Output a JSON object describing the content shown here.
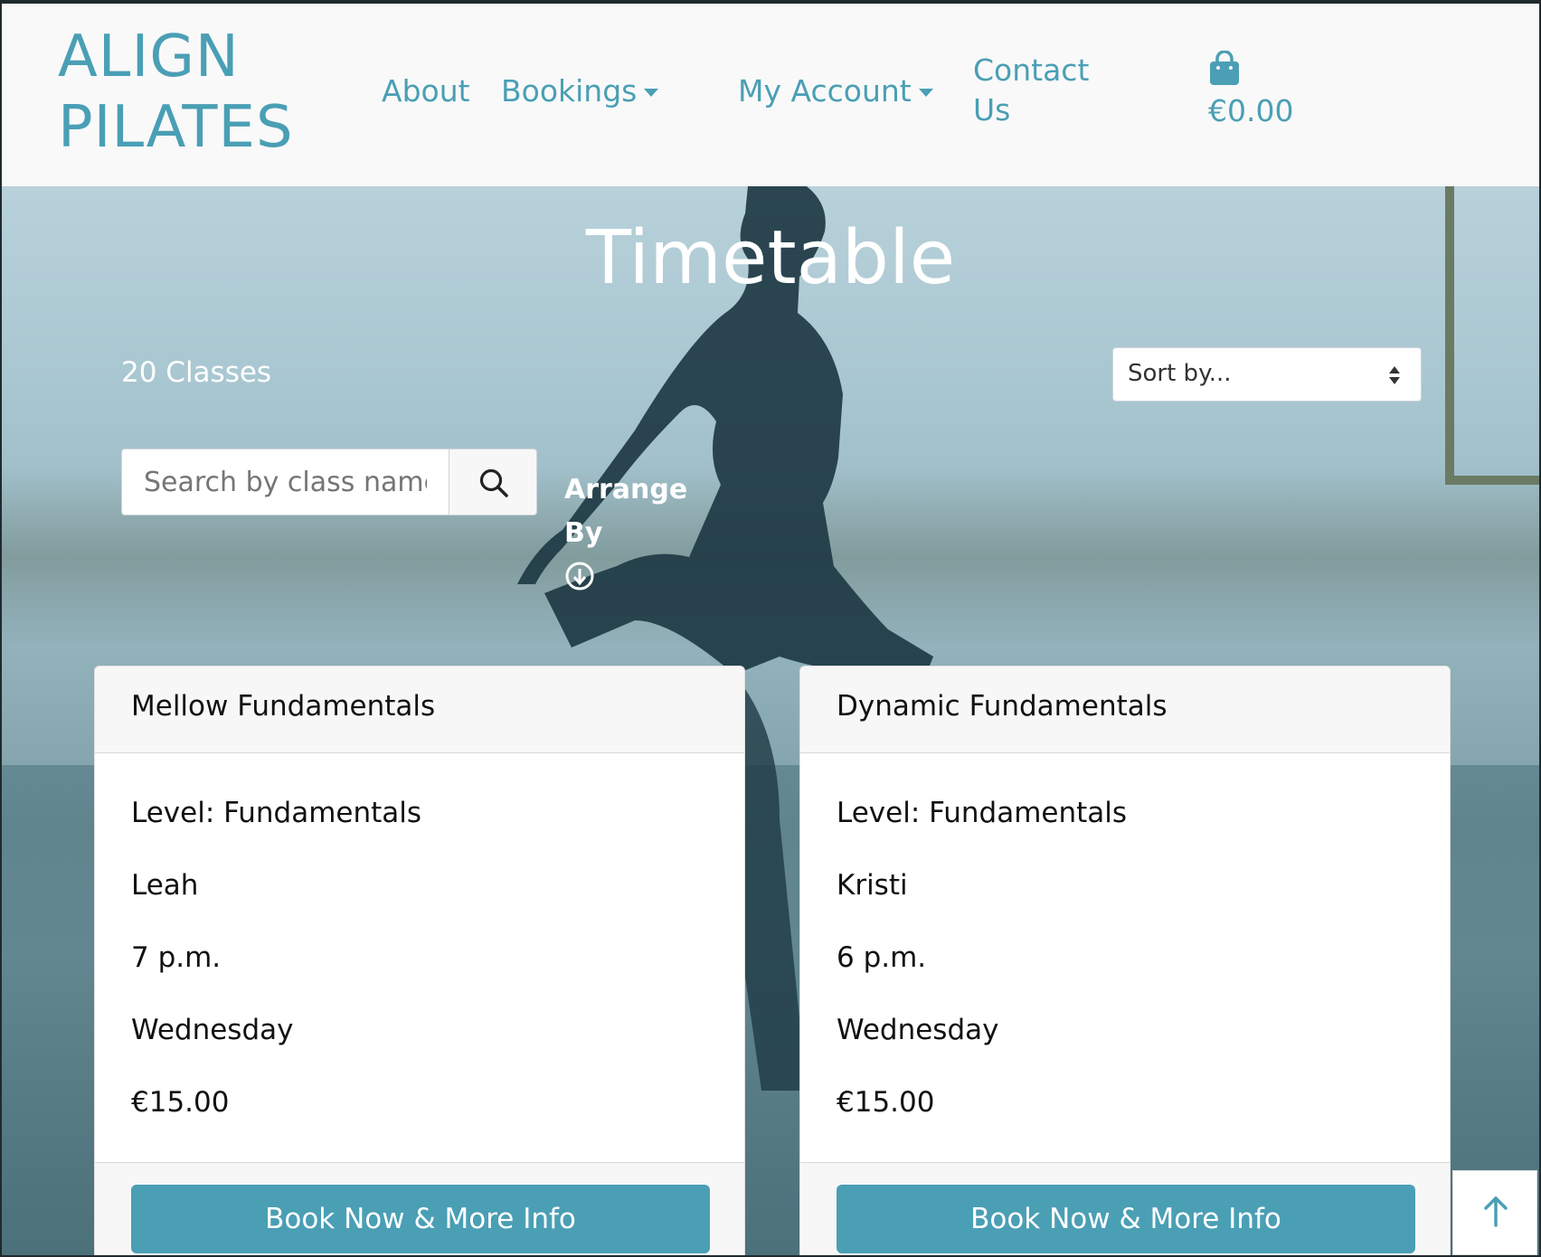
{
  "brand": {
    "line1": "ALIGN",
    "line2": "PILATES"
  },
  "nav": {
    "about": "About",
    "bookings": "Bookings",
    "my_account": "My Account",
    "contact_line1": "Contact",
    "contact_line2": "Us",
    "cart_total": "€0.00"
  },
  "hero": {
    "title": "Timetable",
    "class_count": "20 Classes",
    "sort_label": "Sort by...",
    "search_placeholder": "Search by class name",
    "arrange_line1": "Arrange",
    "arrange_line2": "By"
  },
  "cards": [
    {
      "title": "Mellow Fundamentals",
      "level": "Level: Fundamentals",
      "instructor": "Leah",
      "time": "7 p.m.",
      "day": "Wednesday",
      "price": "€15.00",
      "button": "Book Now & More Info"
    },
    {
      "title": "Dynamic Fundamentals",
      "level": "Level: Fundamentals",
      "instructor": "Kristi",
      "time": "6 p.m.",
      "day": "Wednesday",
      "price": "€15.00",
      "button": "Book Now & More Info"
    }
  ],
  "colors": {
    "brand_teal": "#4a9fb5",
    "navbar_bg": "#f9f9f9",
    "card_bg": "#ffffff"
  },
  "icons": {
    "cart": "shopping-bag-icon",
    "search": "search-icon",
    "arrange": "arrow-down-circle-icon",
    "back_to_top": "arrow-up-icon"
  }
}
